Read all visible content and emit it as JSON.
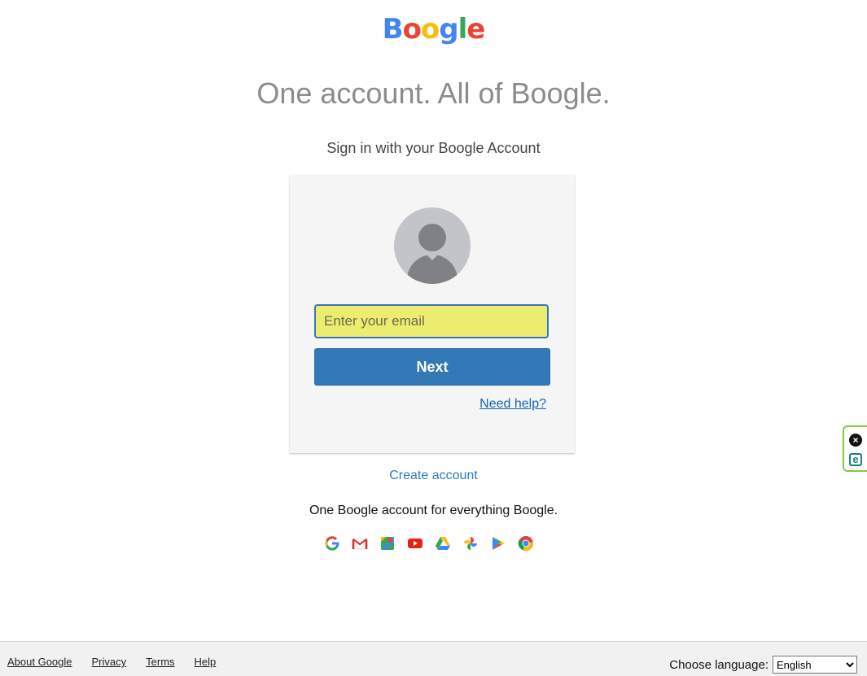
{
  "logo": {
    "letters": [
      "B",
      "o",
      "o",
      "g",
      "l",
      "e"
    ],
    "colors": [
      "#4285f4",
      "#ea4335",
      "#fbbc05",
      "#4285f4",
      "#34a853",
      "#ea4335"
    ]
  },
  "headline": "One account. All of Boogle.",
  "subhead": "Sign in with your Boogle Account",
  "form": {
    "email_placeholder": "Enter your email",
    "email_value": "",
    "next_label": "Next",
    "need_help_label": "Need help?"
  },
  "create_account_label": "Create account",
  "tagline": "One Boogle account for everything Boogle.",
  "app_icons": [
    "google-g-icon",
    "gmail-icon",
    "maps-icon",
    "youtube-icon",
    "drive-icon",
    "photos-icon",
    "play-icon",
    "chrome-icon"
  ],
  "footer": {
    "links": [
      "About Google",
      "Privacy",
      "Terms",
      "Help"
    ],
    "language_label": "Choose language:",
    "language_selected": "English"
  },
  "colors": {
    "primary_button": "#3379b7",
    "input_highlight": "#eced6f",
    "link": "#1a64b4",
    "headline_gray": "#8c8c8c"
  }
}
